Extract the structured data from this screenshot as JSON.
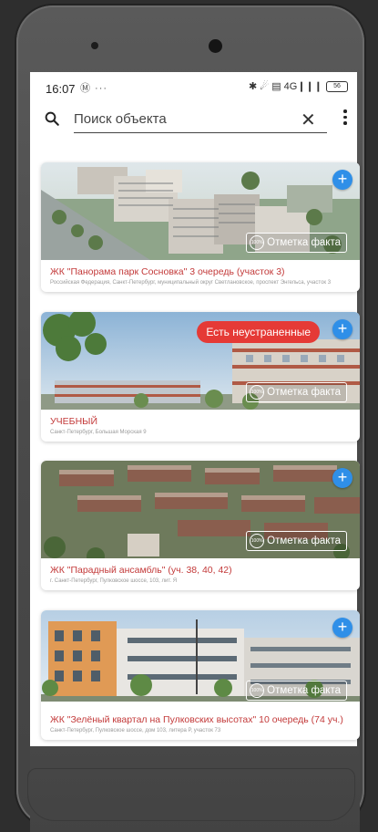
{
  "status_bar": {
    "time": "16:07",
    "left_icons": "Ⓜ ···",
    "right_icons": "✱ ☄ ▤ 4G❙❙❙",
    "battery": "56"
  },
  "search": {
    "placeholder": "Поиск объекта",
    "icon": "search-icon",
    "clear_icon": "close-icon",
    "menu_icon": "more-vert-icon",
    "clear_glyph": "✕"
  },
  "objects": [
    {
      "title": "ЖК \"Панорама парк Сосновка\" 3 очередь (участок 3)",
      "address": "Российская Федерация, Санкт-Петербург, муниципальный округ Светлановское, проспект Энгельса, участок 3",
      "action_label": "Отметка факта",
      "add_label": "+",
      "fact_icon_label": "100%"
    },
    {
      "title": "УЧЕБНЫЙ",
      "address": "Санкт-Петербург, Большая Морская 9",
      "action_label": "Отметка факта",
      "badge": "Есть неустраненные",
      "add_label": "+",
      "fact_icon_label": "100%"
    },
    {
      "title": "ЖК \"Парадный ансамбль\" (уч. 38, 40, 42)",
      "address": "г. Санкт-Петербург, Пулковское шоссе, 103, лит. Я",
      "action_label": "Отметка факта",
      "add_label": "+",
      "fact_icon_label": "100%"
    },
    {
      "title": "ЖК \"Зелёный квартал на Пулковских высотах\" 10 очередь (74 уч.)",
      "address": "Санкт-Петербург, Пулковское шоссе, дом 103, литера Р, участок 73",
      "action_label": "Отметка факта",
      "add_label": "+",
      "fact_icon_label": "100%"
    }
  ],
  "colors": {
    "accent": "#2f8fe8",
    "title_red": "#c33a3a",
    "badge_red": "#e53a36"
  }
}
